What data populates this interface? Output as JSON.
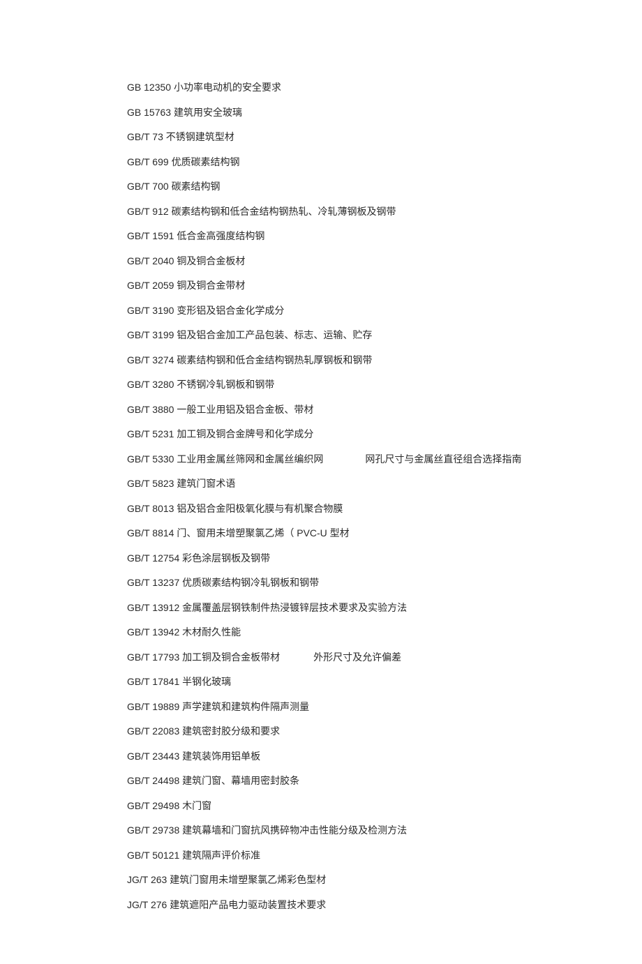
{
  "standards": [
    {
      "code": "GB 12350",
      "title": "小功率电动机的安全要求"
    },
    {
      "code": "GB 15763",
      "title": "建筑用安全玻璃"
    },
    {
      "code": "GB/T 73",
      "title": "不锈钢建筑型材"
    },
    {
      "code": "GB/T 699",
      "title": "优质碳素结构钢"
    },
    {
      "code": "GB/T 700",
      "title": "碳素结构钢"
    },
    {
      "code": "GB/T 912",
      "title": "碳素结构钢和低合金结构钢热轧、冷轧薄钢板及钢带"
    },
    {
      "code": "GB/T 1591",
      "title": "低合金高强度结构钢"
    },
    {
      "code": "GB/T 2040",
      "title": "铜及铜合金板材"
    },
    {
      "code": "GB/T 2059",
      "title": "铜及铜合金带材"
    },
    {
      "code": "GB/T 3190",
      "title": "变形铝及铝合金化学成分"
    },
    {
      "code": "GB/T 3199",
      "title": "铝及铝合金加工产品包装、标志、运输、贮存"
    },
    {
      "code": "GB/T 3274",
      "title": "碳素结构钢和低合金结构钢热轧厚钢板和钢带"
    },
    {
      "code": "GB/T 3280",
      "title": "不锈钢冷轧钢板和钢带"
    },
    {
      "code": "GB/T 3880",
      "title": "一般工业用铝及铝合金板、带材"
    },
    {
      "code": "GB/T 5231",
      "title": "加工铜及铜合金牌号和化学成分"
    },
    {
      "code": "GB/T 5330",
      "title": "工业用金属丝筛网和金属丝编织网",
      "suffix": "网孔尺寸与金属丝直径组合选择指南",
      "gap": 60
    },
    {
      "code": "GB/T 5823",
      "title": "建筑门窗术语"
    },
    {
      "code": "GB/T 8013",
      "title": "铝及铝合金阳极氧化膜与有机聚合物膜"
    },
    {
      "code": "GB/T 8814",
      "title": "门、窗用未增塑聚氯乙烯（ PVC-U 型材"
    },
    {
      "code": "GB/T 12754",
      "title": "彩色涂层钢板及钢带"
    },
    {
      "code": "GB/T 13237",
      "title": "优质碳素结构钢冷轧钢板和钢带"
    },
    {
      "code": "GB/T 13912",
      "title": "金属覆盖层钢铁制件热浸镀锌层技术要求及实验方法"
    },
    {
      "code": "GB/T 13942",
      "title": "木材耐久性能"
    },
    {
      "code": "GB/T 17793",
      "title": "加工铜及铜合金板带材",
      "suffix": "外形尺寸及允许偏差",
      "gap": 48
    },
    {
      "code": "GB/T 17841",
      "title": "半钢化玻璃"
    },
    {
      "code": "GB/T 19889",
      "title": "声学建筑和建筑构件隔声测量"
    },
    {
      "code": "GB/T 22083",
      "title": "建筑密封胶分级和要求"
    },
    {
      "code": "GB/T 23443",
      "title": "建筑装饰用铝单板"
    },
    {
      "code": "GB/T 24498",
      "title": "建筑门窗、幕墙用密封胶条"
    },
    {
      "code": "GB/T 29498",
      "title": "木门窗"
    },
    {
      "code": "GB/T 29738",
      "title": "建筑幕墙和门窗抗风携碎物冲击性能分级及检测方法"
    },
    {
      "code": "GB/T 50121",
      "title": "建筑隔声评价标准"
    },
    {
      "code": "JG/T 263",
      "title": "建筑门窗用未增塑聚氯乙烯彩色型材"
    },
    {
      "code": "JG/T 276",
      "title": "建筑遮阳产品电力驱动装置技术要求",
      "extraTop": 10
    }
  ]
}
